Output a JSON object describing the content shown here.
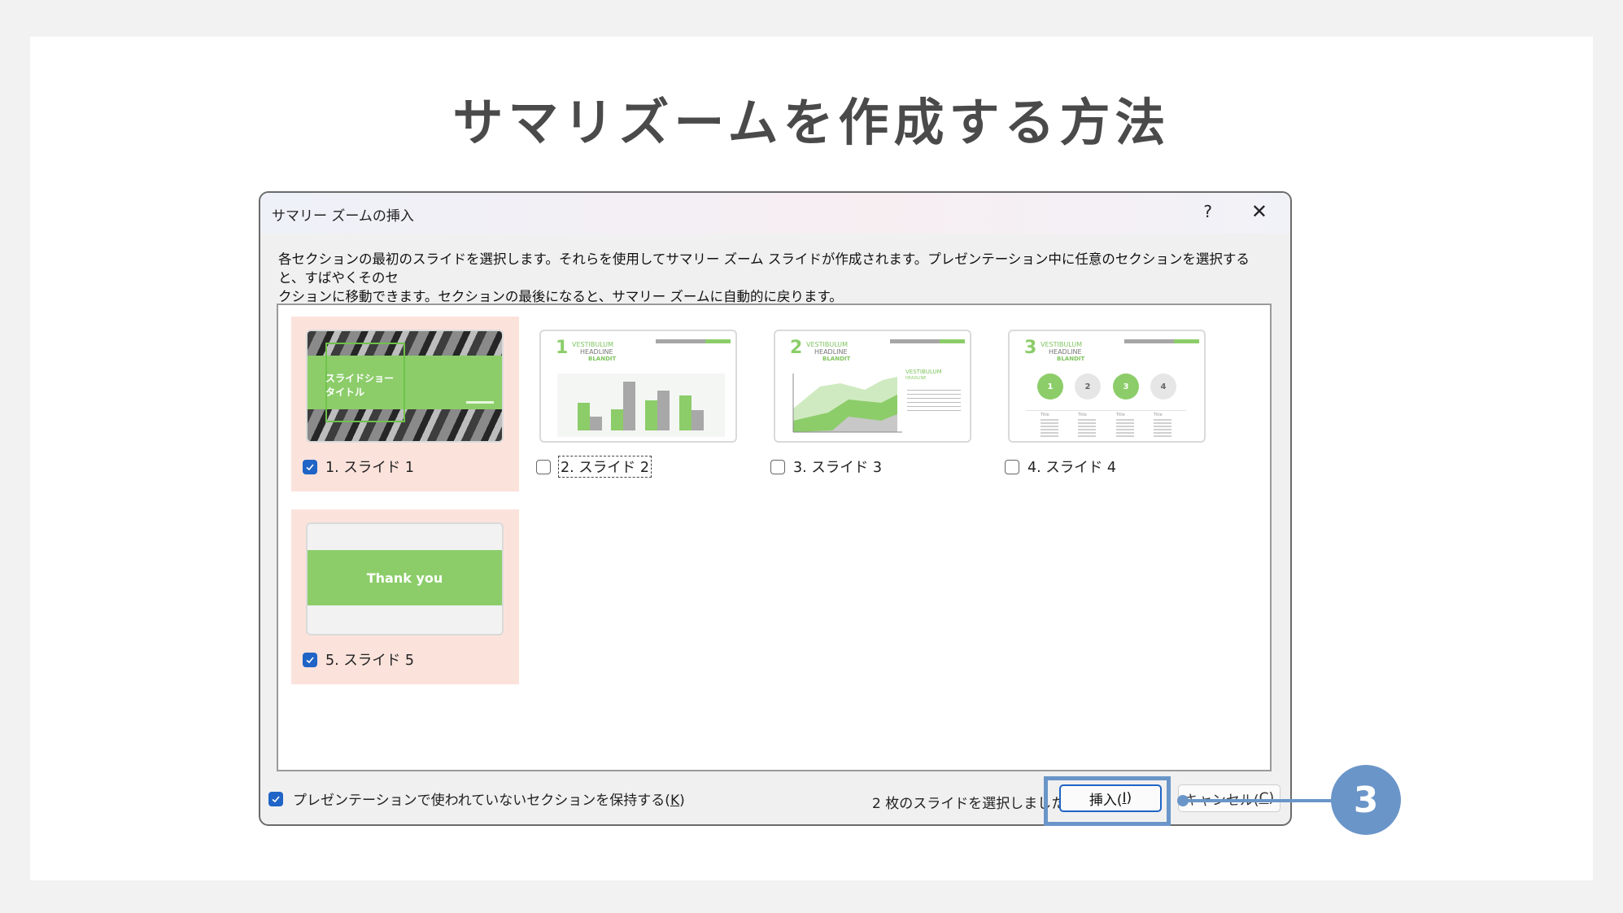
{
  "page": {
    "title": "サマリズームを作成する方法"
  },
  "dialog": {
    "title": "サマリー ズームの挿入",
    "help_label": "?",
    "close_label": "✕",
    "description_line1": "各セクションの最初のスライドを選択します。それらを使用してサマリー ズーム スライドが作成されます。プレゼンテーション中に任意のセクションを選択すると、すばやくそのセ",
    "description_line2": "クションに移動できます。セクションの最後になると、サマリー ズームに自動的に戻ります。",
    "slides": [
      {
        "label": "1. スライド 1",
        "checked": true,
        "thumb_title": "スライドショー\nタイトル"
      },
      {
        "label": "2. スライド 2",
        "checked": false,
        "number": "1",
        "headline": [
          "VESTIBULUM",
          "HEADLINE",
          "BLANDIT"
        ]
      },
      {
        "label": "3. スライド 3",
        "checked": false,
        "number": "2",
        "headline": [
          "VESTIBULUM",
          "HEADLINE",
          "BLANDIT"
        ],
        "side_heading": [
          "VESTIBULUM",
          "HEADLINE"
        ]
      },
      {
        "label": "4. スライド 4",
        "checked": false,
        "number": "3",
        "headline": [
          "VESTIBULUM",
          "HEADLINE",
          "BLANDIT"
        ],
        "steps": [
          "1",
          "2",
          "3",
          "4"
        ],
        "step_title": "Title"
      },
      {
        "label": "5. スライド 5",
        "checked": true,
        "thumb_title": "Thank you"
      }
    ],
    "keep_sections": {
      "label_main": "プレゼンテーションで使われていないセクションを保持する(",
      "label_key": "K",
      "label_end": ")",
      "checked": true
    },
    "status": "2 枚のスライドを選択しました",
    "insert_button": {
      "main": "挿入(",
      "key": "I",
      "end": ")"
    },
    "cancel_button": {
      "main": "キャンセル(",
      "key": "C",
      "end": ")"
    }
  },
  "annotation": {
    "step_number": "3",
    "color": "#6a95c8"
  },
  "colors": {
    "accent_green": "#8ccd6a",
    "checkbox_blue": "#1f64c6",
    "selected_bg": "#fbe3dc"
  }
}
